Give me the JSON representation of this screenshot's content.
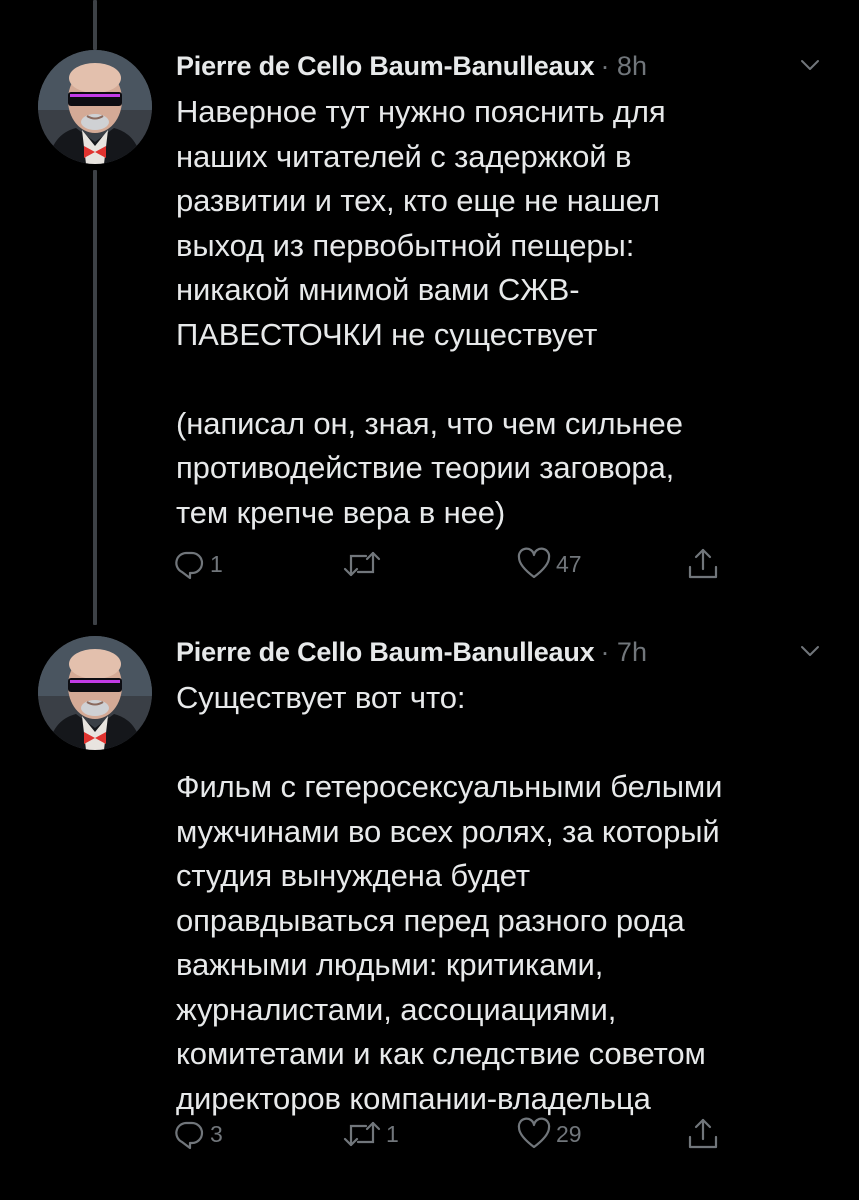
{
  "tweets": [
    {
      "author": "Pierre de Cello Baum-Banulleaux",
      "time_meta": "· 8h",
      "text": "Наверное тут нужно пояснить для\nнаших читателей с задержкой в\nразвитии и тех, кто еще не нашел\nвыход из первобытной пещеры:\nникакой мнимой вами СЖВ-\nПАВЕСТОЧКИ не существует\n\n(написал он, зная, что чем сильнее\nпротиводействие теории заговора,\nтем крепче вера в нее)",
      "replies": "1",
      "retweets": "",
      "likes": "47"
    },
    {
      "author": "Pierre de Cello Baum-Banulleaux",
      "time_meta": "· 7h",
      "text": "Существует вот что:\n\nФильм с гетеросексуальными белыми\nмужчинами во всех ролях, за который\nстудия вынуждена будет\nоправдываться перед разного рода\nважными людьми: критиками,\nжурналистами, ассоциациями,\nкомитетами и как следствие советом\nдиректоров компании-владельца",
      "replies": "3",
      "retweets": "1",
      "likes": "29"
    }
  ],
  "icons": {
    "reply": "reply-icon",
    "retweet": "retweet-icon",
    "like": "heart-icon",
    "share": "share-icon",
    "menu": "chevron-down-icon"
  },
  "colors": {
    "background": "#000000",
    "text": "#e7e9ea",
    "muted": "#71767b",
    "thread_line": "#3d4146"
  }
}
